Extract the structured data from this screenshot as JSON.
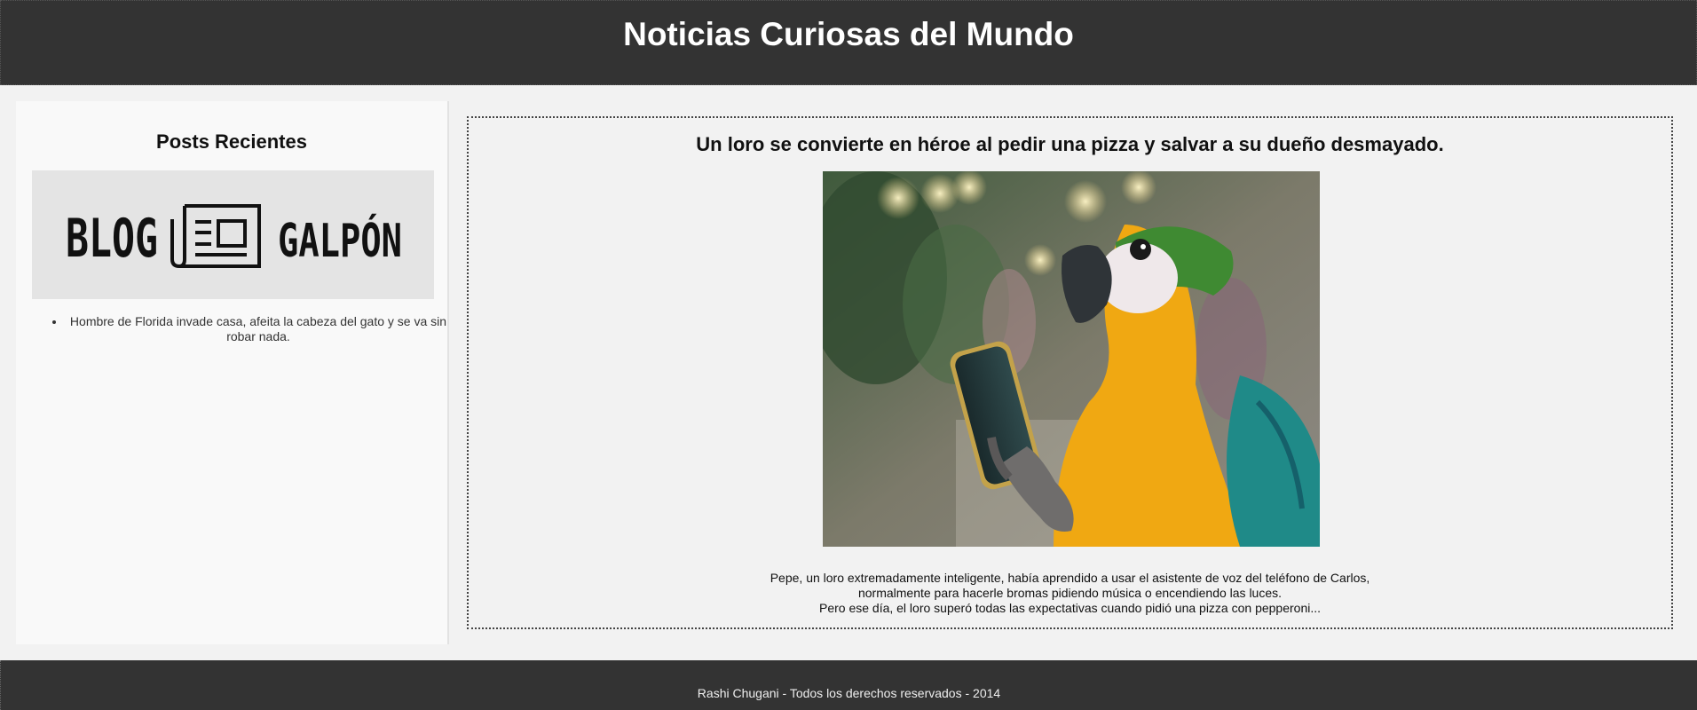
{
  "header": {
    "title": "Noticias Curiosas del Mundo"
  },
  "sidebar": {
    "title": "Posts Recientes",
    "logo": {
      "text_left": "BLOG",
      "text_right": "GALPÓN",
      "icon": "newspaper-icon"
    },
    "recent_posts": [
      {
        "label": "Hombre de Florida invade casa, afeita la cabeza del gato y se va sin robar nada."
      }
    ]
  },
  "article": {
    "title": "Un loro se convierte en héroe al pedir una pizza y salvar a su dueño desmayado.",
    "image": "parrot-holding-smartphone-photo",
    "paragraph_lines": [
      "Pepe, un loro extremadamente inteligente, había aprendido a usar el asistente de voz del teléfono de Carlos,",
      "normalmente para hacerle bromas pidiendo música o encendiendo las luces.",
      "Pero ese día, el loro superó todas las expectativas cuando pidió una pizza con pepperoni..."
    ]
  },
  "footer": {
    "text": "Rashi Chugani - Todos los derechos reservados - 2014"
  },
  "colors": {
    "header_bg": "#333333",
    "footer_bg": "#333333",
    "page_bg": "#f2f2f2",
    "sidebar_bg": "#f9f9f9"
  }
}
